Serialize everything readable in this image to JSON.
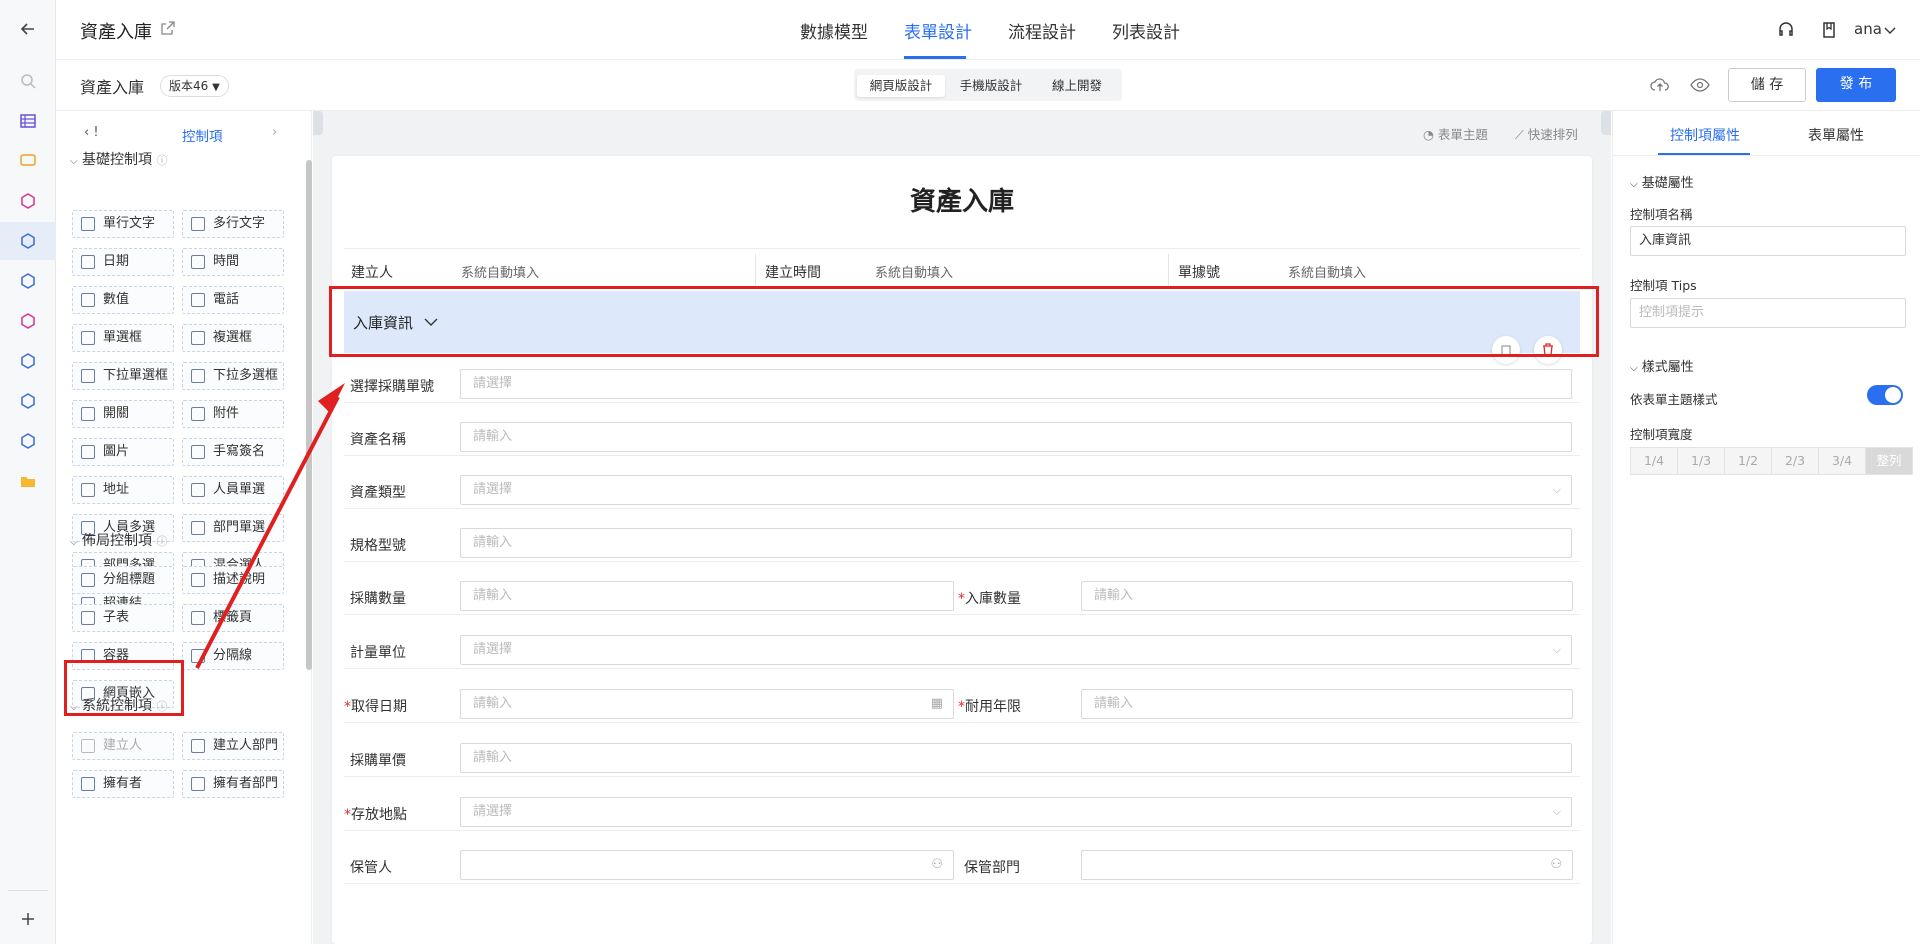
{
  "app": {
    "title": "資產入庫",
    "user": "ana"
  },
  "nav": {
    "tabs": [
      "數據模型",
      "表單設計",
      "流程設計",
      "列表設計"
    ],
    "active": "表單設計"
  },
  "subbar": {
    "form_name": "資產入庫",
    "version": "版本46",
    "modes": [
      "網頁版設計",
      "手機版設計",
      "線上開發"
    ],
    "save_label": "儲 存",
    "publish_label": "發 布"
  },
  "left_panel": {
    "tab_label": "控制項",
    "tab_prev": "!",
    "basic": {
      "title": "基礎控制項",
      "items": [
        "單行文字",
        "多行文字",
        "日期",
        "時間",
        "數值",
        "電話",
        "單選框",
        "複選框",
        "下拉單選框",
        "下拉多選框",
        "開關",
        "附件",
        "圖片",
        "手寫簽名",
        "地址",
        "人員單選",
        "人員多選",
        "部門單選",
        "部門多選",
        "混合選人",
        "超連結"
      ]
    },
    "layout": {
      "title": "佈局控制項",
      "items": [
        "分組標題",
        "描述說明",
        "子表",
        "標籤頁",
        "容器",
        "分隔線",
        "網頁嵌入"
      ]
    },
    "system": {
      "title": "系統控制項",
      "items": [
        "建立人",
        "建立人部門",
        "擁有者",
        "擁有者部門"
      ]
    }
  },
  "canvas": {
    "toolbar": {
      "theme": "表單主題",
      "arrange": "快速排列"
    },
    "form_title": "資產入庫",
    "meta": [
      {
        "label": "建立人",
        "value": "系統自動填入"
      },
      {
        "label": "建立時間",
        "value": "系統自動填入"
      },
      {
        "label": "單據號",
        "value": "系統自動填入"
      }
    ],
    "group_title": "入庫資訊",
    "fields": {
      "purchase_no": {
        "label": "選擇採購單號",
        "placeholder": "請選擇"
      },
      "asset_name": {
        "label": "資產名稱",
        "placeholder": "請輸入"
      },
      "asset_type": {
        "label": "資產類型",
        "placeholder": "請選擇"
      },
      "spec": {
        "label": "規格型號",
        "placeholder": "請輸入"
      },
      "purchase_qty": {
        "label": "採購數量",
        "placeholder": "請輸入"
      },
      "in_qty": {
        "label": "入庫數量",
        "placeholder": "請輸入"
      },
      "unit": {
        "label": "計量單位",
        "placeholder": "請選擇"
      },
      "acq_date": {
        "label": "取得日期",
        "placeholder": "請輸入"
      },
      "useful_life": {
        "label": "耐用年限",
        "placeholder": "請輸入"
      },
      "unit_price": {
        "label": "採購單價",
        "placeholder": "請輸入"
      },
      "location": {
        "label": "存放地點",
        "placeholder": "請選擇"
      },
      "custodian": {
        "label": "保管人",
        "placeholder": ""
      },
      "custodian_dept": {
        "label": "保管部門",
        "placeholder": ""
      }
    }
  },
  "right_panel": {
    "tabs": [
      "控制項屬性",
      "表單屬性"
    ],
    "basic_title": "基礎屬性",
    "name_label": "控制項名稱",
    "name_value": "入庫資訊",
    "tips_label": "控制項 Tips",
    "tips_placeholder": "控制項提示",
    "style_title": "樣式屬性",
    "theme_label": "依表單主題樣式",
    "width_label": "控制項寬度",
    "width_options": [
      "1/4",
      "1/3",
      "1/2",
      "2/3",
      "3/4",
      "整列"
    ]
  },
  "colors": {
    "accent": "#2a6ff0",
    "annotation": "#e02020",
    "group_bg": "#dde9fb"
  }
}
